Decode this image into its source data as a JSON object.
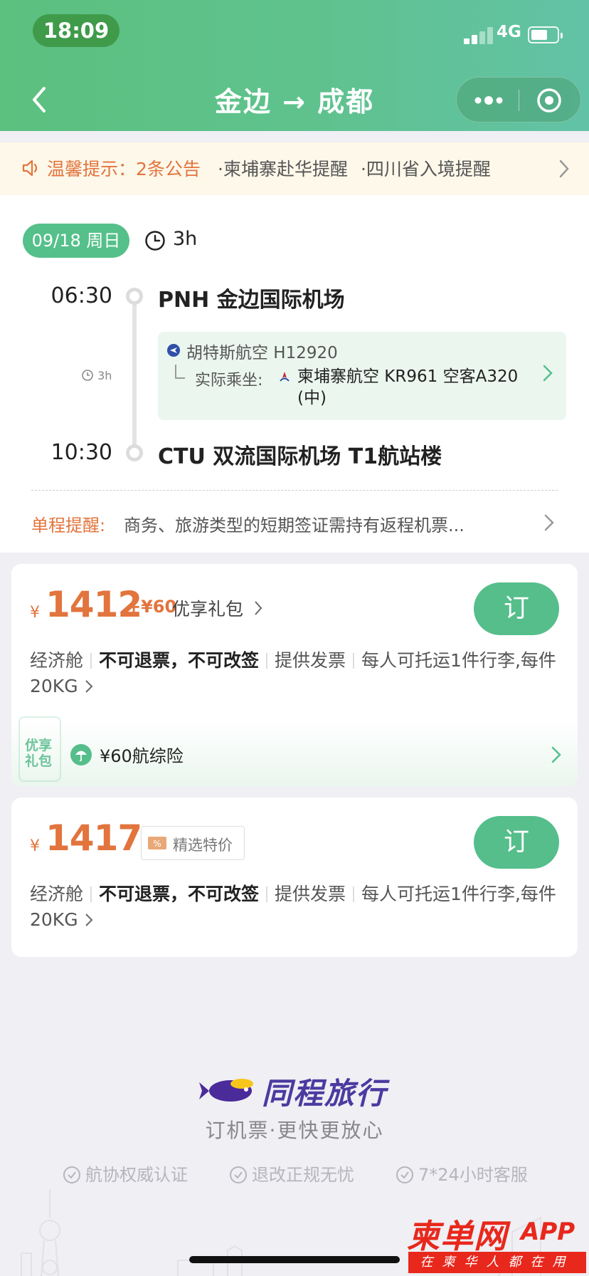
{
  "status_bar": {
    "time": "18:09",
    "network": "4G"
  },
  "header": {
    "title": "金边 → 成都"
  },
  "notice": {
    "label": "温馨提示：2条公告",
    "items": [
      "·柬埔寨赴华提醒",
      "·四川省入境提醒"
    ]
  },
  "flight": {
    "date": "09/18 周日",
    "duration": "3h",
    "departure": {
      "time": "06:30",
      "airport": "PNH 金边国际机场"
    },
    "arrival": {
      "time": "10:30",
      "airport": "CTU 双流国际机场 T1航站楼"
    },
    "mid_duration": "3h",
    "marketing_carrier": "胡特斯航空 H12920",
    "actual_label": "实际乘坐:",
    "actual_carrier": "柬埔寨航空 KR961 空客A320 (中)",
    "trip_reminder_label": "单程提醒:",
    "trip_reminder_text": "商务、旅游类型的短期签证需持有返程机票..."
  },
  "offers": [
    {
      "currency": "¥",
      "price": "1412",
      "gift_price": "+¥60",
      "gift_label": "优享礼包",
      "book_label": "订",
      "cabin": "经济舱",
      "refund": "不可退票，不可改签",
      "invoice": "提供发票",
      "baggage": "每人可托运1件行李,每件20KG",
      "gift_badge": "优享礼包",
      "insurance": "¥60航综险"
    },
    {
      "currency": "¥",
      "price": "1417",
      "tag": "精选特价",
      "book_label": "订",
      "cabin": "经济舱",
      "refund": "不可退票，不可改签",
      "invoice": "提供发票",
      "baggage": "每人可托运1件行李,每件20KG"
    }
  ],
  "footer": {
    "brand": "同程旅行",
    "slogan": "订机票·更快更放心",
    "badges": [
      "航协权威认证",
      "退改正规无忧",
      "7*24小时客服"
    ]
  },
  "watermark": {
    "main": "柬单网",
    "app": "APP",
    "sub": "在柬华人都在用"
  },
  "colors": {
    "accent": "#55be8b",
    "price": "#e2743d",
    "brand": "#4b3aa0",
    "watermark": "#e8281c"
  }
}
